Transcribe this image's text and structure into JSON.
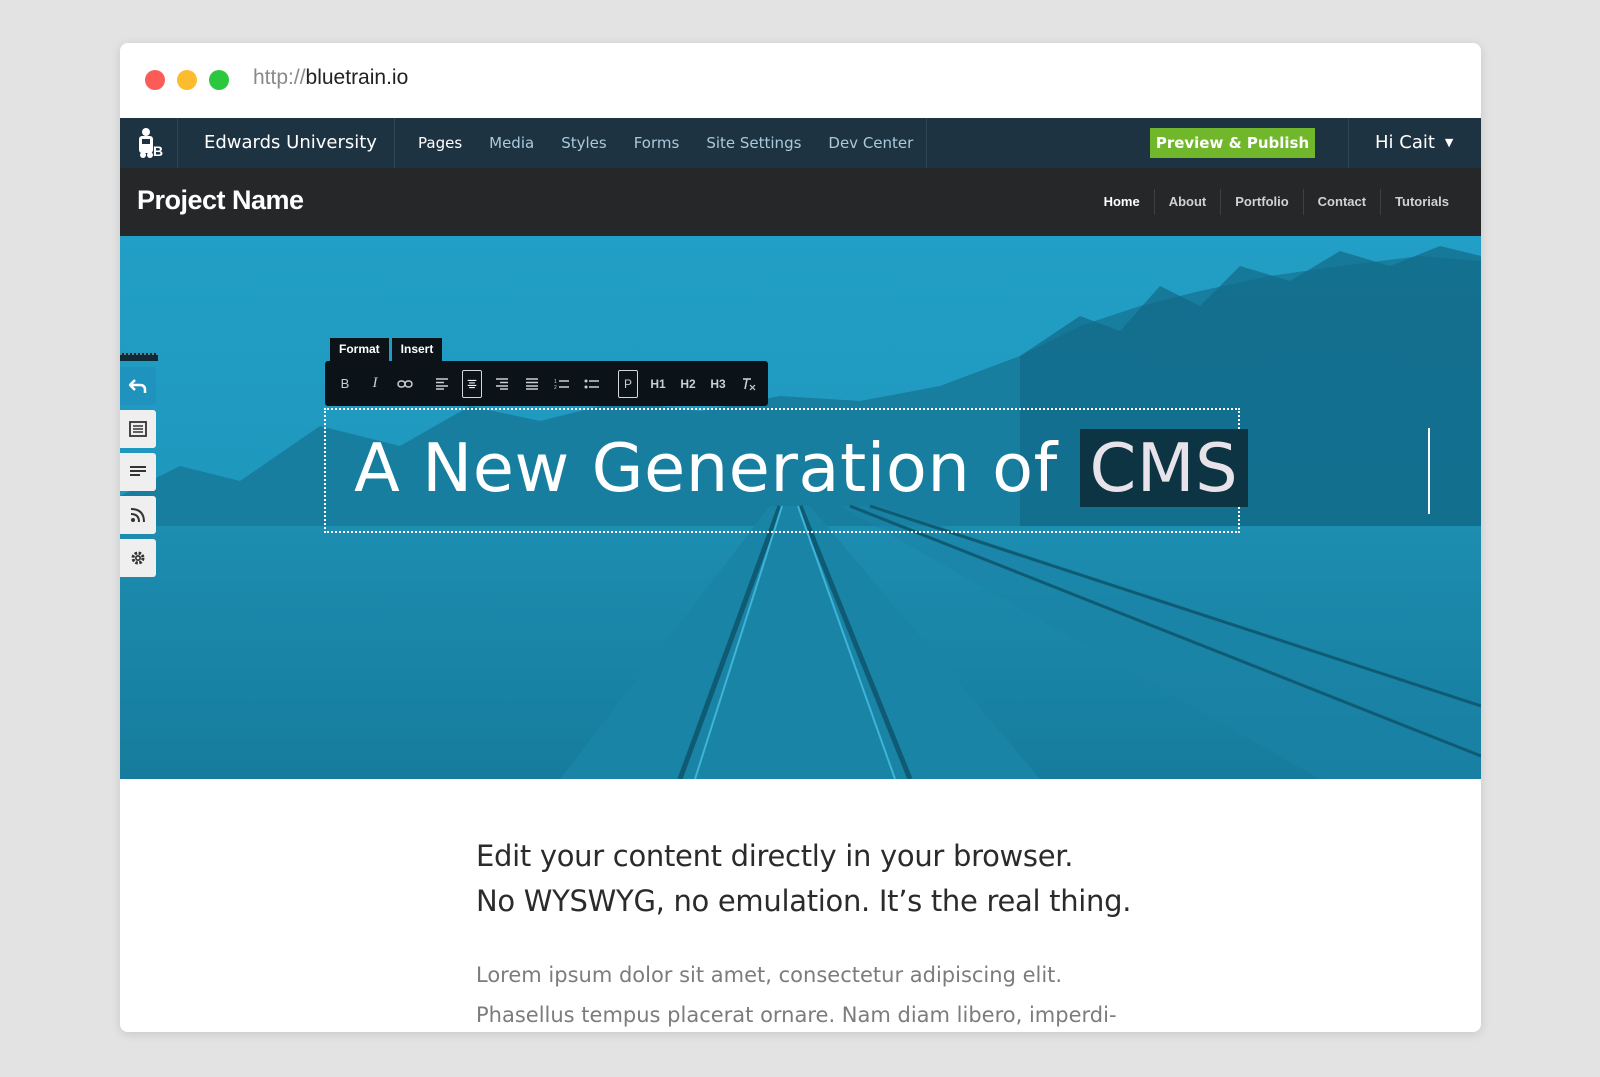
{
  "browser": {
    "url_protocol": "http://",
    "url_domain": "bluetrain.io"
  },
  "cms": {
    "site_name": "Edwards University",
    "nav": [
      "Pages",
      "Media",
      "Styles",
      "Forms",
      "Site Settings",
      "Dev Center"
    ],
    "active_nav": "Pages",
    "publish_label": "Preview & Publish",
    "user_greeting": "Hi Cait",
    "colors": {
      "bar": "#1e3341",
      "publish": "#71b72c"
    }
  },
  "site": {
    "project_name": "Project Name",
    "nav": [
      "Home",
      "About",
      "Portfolio",
      "Contact",
      "Tutorials"
    ],
    "active_nav": "Home"
  },
  "editor": {
    "tabs": [
      "Format",
      "Insert"
    ],
    "toolbar": {
      "bold": "B",
      "italic": "I",
      "paragraph": "P",
      "h1": "H1",
      "h2": "H2",
      "h3": "H3"
    },
    "side_tools": [
      "undo-icon",
      "template-icon",
      "text-block-icon",
      "rss-icon",
      "gear-icon"
    ]
  },
  "hero": {
    "headline_main": "A New Generation of ",
    "headline_selected": "CMS",
    "overlay_color": "#1f9ac0"
  },
  "content": {
    "lead_line1": "Edit your content directly in your browser.",
    "lead_line2": "No WYSWYG, no emulation. It’s the real thing.",
    "body_line1": "Lorem ipsum dolor sit amet, consectetur adipiscing elit.",
    "body_line2": "Phasellus tempus placerat ornare. Nam diam libero, imperdi-"
  }
}
